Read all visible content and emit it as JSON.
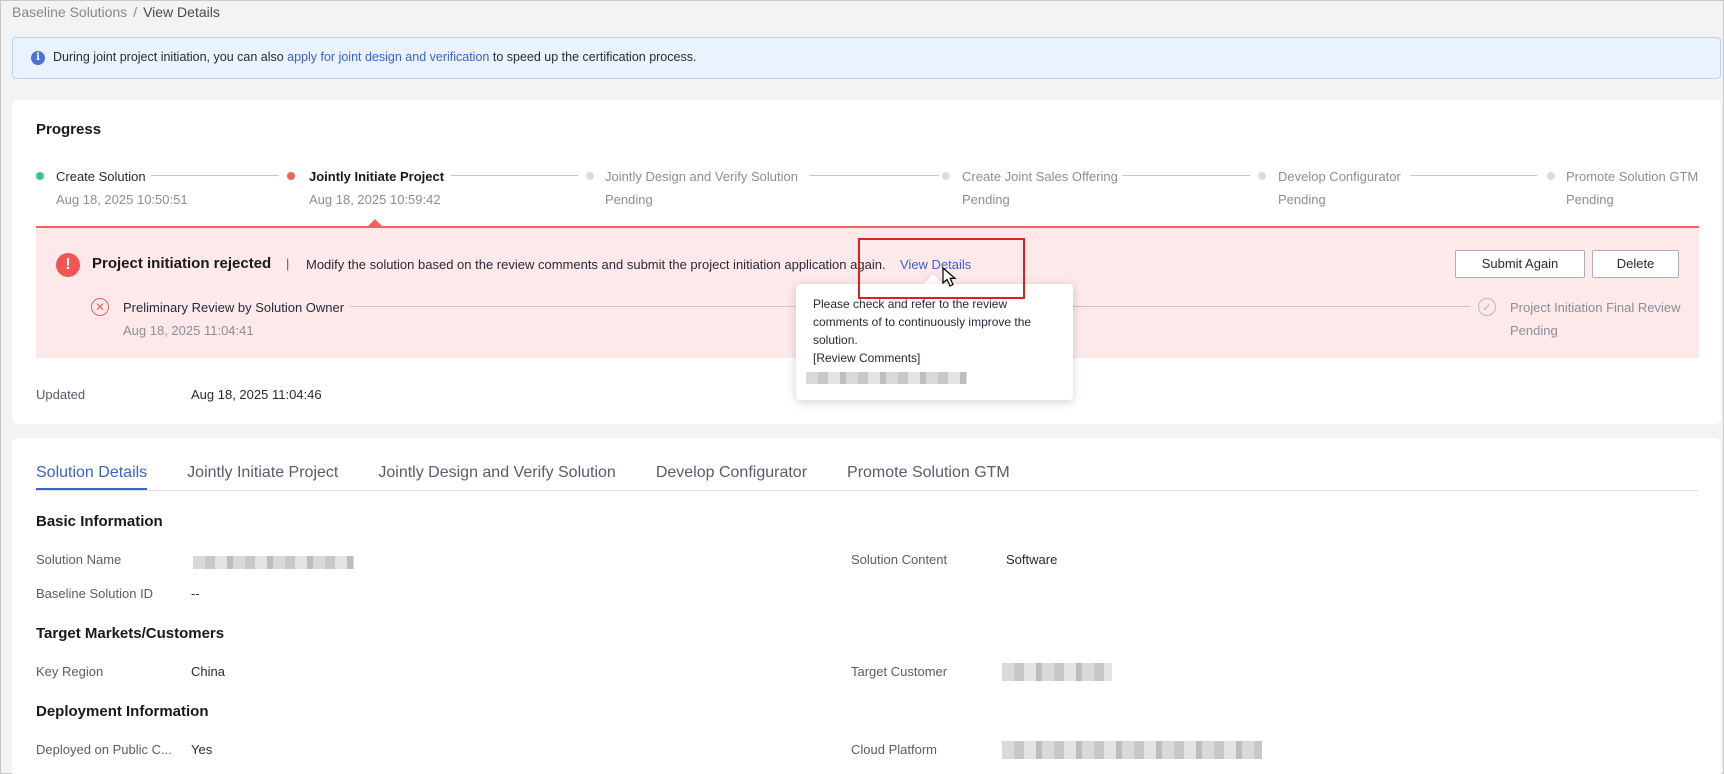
{
  "breadcrumb": {
    "parent": "Baseline Solutions",
    "separator": "/",
    "current": "View Details"
  },
  "info_bar": {
    "text_before": "During joint project initiation, you can also ",
    "link": "apply for joint design and verification",
    "text_after": " to speed up the certification process."
  },
  "progress": {
    "title": "Progress",
    "steps": [
      {
        "label": "Create Solution",
        "sub": "Aug 18, 2025 10:50:51",
        "state": "done"
      },
      {
        "label": "Jointly Initiate Project",
        "sub": "Aug 18, 2025 10:59:42",
        "state": "active"
      },
      {
        "label": "Jointly Design and Verify Solution",
        "sub": "Pending",
        "state": "pending"
      },
      {
        "label": "Create Joint Sales Offering",
        "sub": "Pending",
        "state": "pending"
      },
      {
        "label": "Develop Configurator",
        "sub": "Pending",
        "state": "pending"
      },
      {
        "label": "Promote Solution GTM",
        "sub": "Pending",
        "state": "pending"
      }
    ]
  },
  "rejection": {
    "title": "Project initiation rejected",
    "separator": "|",
    "message": "Modify the solution based on the review comments and submit the project initiation application again.",
    "link": "View Details",
    "submit_again": "Submit Again",
    "delete": "Delete",
    "substeps": [
      {
        "label": "Preliminary Review by Solution Owner",
        "sub": "Aug 18, 2025 11:04:41",
        "state": "rejected"
      },
      {
        "label": "Project Initiation Final Review",
        "sub": "Pending",
        "state": "pending"
      }
    ]
  },
  "tooltip": {
    "line1": "Please check and refer to the review",
    "line2": "comments of to continuously improve the",
    "line3": "solution.",
    "line4": "[Review Comments]"
  },
  "updated": {
    "label": "Updated",
    "value": "Aug 18, 2025 11:04:46"
  },
  "tabs": [
    {
      "label": "Solution Details",
      "active": true
    },
    {
      "label": "Jointly Initiate Project",
      "active": false
    },
    {
      "label": "Jointly Design and Verify Solution",
      "active": false
    },
    {
      "label": "Develop Configurator",
      "active": false
    },
    {
      "label": "Promote Solution GTM",
      "active": false
    }
  ],
  "basic_info": {
    "title": "Basic Information",
    "solution_name_label": "Solution Name",
    "solution_content_label": "Solution Content",
    "solution_content_value": "Software",
    "baseline_id_label": "Baseline Solution ID",
    "baseline_id_value": "--"
  },
  "target_markets": {
    "title": "Target Markets/Customers",
    "key_region_label": "Key Region",
    "key_region_value": "China",
    "target_customer_label": "Target Customer"
  },
  "deployment": {
    "title": "Deployment Information",
    "public_cloud_label": "Deployed on Public C...",
    "public_cloud_value": "Yes",
    "cloud_platform_label": "Cloud Platform"
  },
  "colors": {
    "accent": "#3b63c9",
    "error": "#f0625c",
    "success": "#3fc18a",
    "reject_bg": "#fde9e9"
  }
}
